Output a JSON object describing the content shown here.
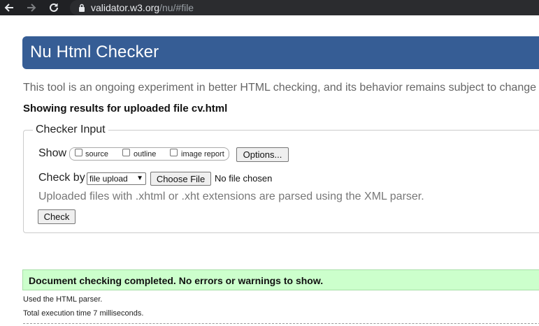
{
  "browser": {
    "url_host": "validator.w3.org",
    "url_path": "/nu/#file",
    "icons": [
      "back-arrow-icon",
      "forward-arrow-icon",
      "reload-icon",
      "lock-icon"
    ]
  },
  "header": {
    "title": "Nu Html Checker"
  },
  "intro": "This tool is an ongoing experiment in better HTML checking, and its behavior remains subject to change",
  "showing": "Showing results for uploaded file cv.html",
  "checker_input": {
    "legend": "Checker Input",
    "show_label": "Show",
    "show_options": [
      {
        "label": "source",
        "checked": false
      },
      {
        "label": "outline",
        "checked": false
      },
      {
        "label": "image report",
        "checked": false
      }
    ],
    "options_button": "Options...",
    "check_by_label": "Check by",
    "check_by_selected": "file upload",
    "choose_file_button": "Choose File",
    "no_file_text": "No file chosen",
    "note": "Uploaded files with .xhtml or .xht extensions are parsed using the XML parser.",
    "check_button": "Check"
  },
  "result": {
    "success_message": "Document checking completed. No errors or warnings to show.",
    "parser_text": "Used the HTML parser.",
    "time_text": "Total execution time 7 milliseconds."
  },
  "colors": {
    "header_bg": "#365d95",
    "success_bg": "#ccffcc",
    "chrome_bg": "#202124"
  }
}
